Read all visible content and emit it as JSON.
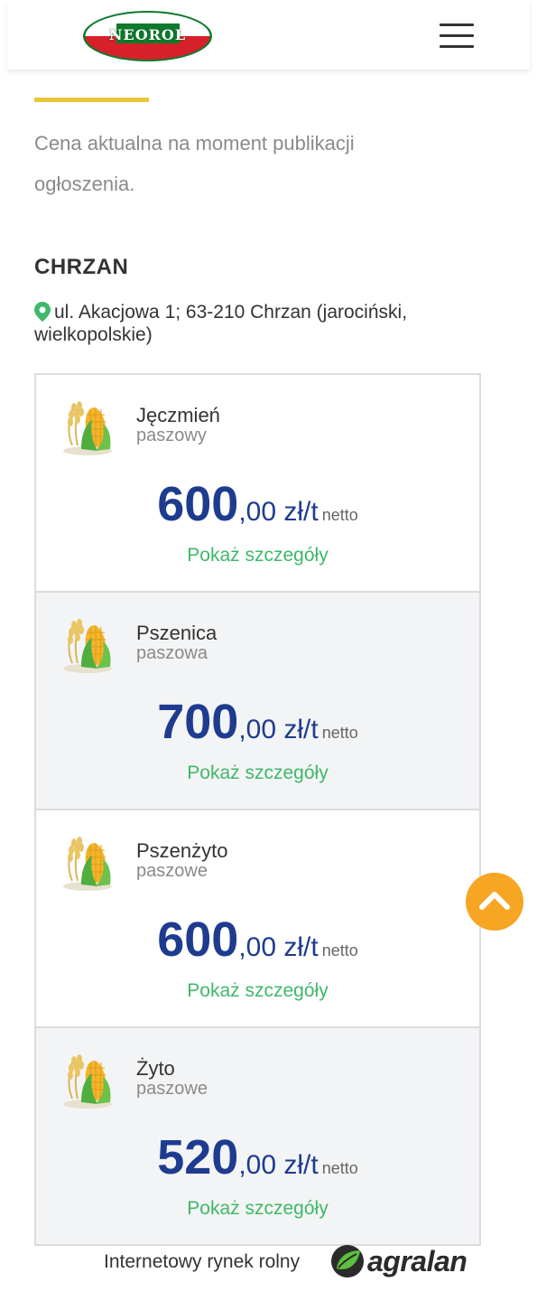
{
  "header": {
    "logo_text": "NEOROL",
    "menu_icon": "hamburger-menu-icon"
  },
  "colors": {
    "accent": "#e8c73a",
    "price_blue": "#1e3c8f",
    "link_green": "#3fb86a",
    "scroll_orange": "#f6a623"
  },
  "notice": "Cena aktualna na moment publikacji ogłoszenia.",
  "location": {
    "city": "CHRZAN",
    "address": "ul. Akacjowa 1; 63-210 Chrzan (jarociński, wielkopolskie)",
    "pin_icon": "location-pin-icon"
  },
  "offers": [
    {
      "name": "Jęczmień",
      "type": "paszowy",
      "price_int": "600",
      "price_dec": ",00 zł/t",
      "net": "netto",
      "details": "Pokaż szczegóły",
      "icon": "grain-corn-icon"
    },
    {
      "name": "Pszenica",
      "type": "paszowa",
      "price_int": "700",
      "price_dec": ",00 zł/t",
      "net": "netto",
      "details": "Pokaż szczegóły",
      "icon": "grain-corn-icon"
    },
    {
      "name": "Pszenżyto",
      "type": "paszowe",
      "price_int": "600",
      "price_dec": ",00 zł/t",
      "net": "netto",
      "details": "Pokaż szczegóły",
      "icon": "grain-corn-icon"
    },
    {
      "name": "Żyto",
      "type": "paszowe",
      "price_int": "520",
      "price_dec": ",00 zł/t",
      "net": "netto",
      "details": "Pokaż szczegóły",
      "icon": "grain-corn-icon"
    }
  ],
  "scroll_top_icon": "chevron-up-icon",
  "footer": {
    "text": "Internetowy rynek rolny",
    "brand": "agralan"
  }
}
